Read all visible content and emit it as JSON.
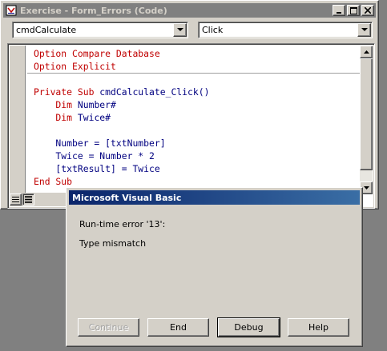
{
  "window": {
    "title": "Exercise - Form_Errors (Code)",
    "icon": "vba-module-icon"
  },
  "object_combo": {
    "value": "cmdCalculate"
  },
  "procedure_combo": {
    "value": "Click"
  },
  "code": {
    "header_lines": [
      "Option Compare Database",
      "Option Explicit"
    ],
    "proc_lines": [
      {
        "kw": "Private Sub",
        "rest": " cmdCalculate_Click()"
      },
      {
        "kw": "    Dim",
        "rest": " Number#"
      },
      {
        "kw": "    Dim",
        "rest": " Twice#"
      },
      {
        "kw": "",
        "rest": ""
      },
      {
        "kw": "",
        "rest": "    Number = [txtNumber]"
      },
      {
        "kw": "",
        "rest": "    Twice = Number * 2"
      },
      {
        "kw": "",
        "rest": "    [txtResult] = Twice"
      },
      {
        "kw": "End Sub",
        "rest": ""
      }
    ]
  },
  "dialog": {
    "title": "Microsoft Visual Basic",
    "error_line": "Run-time error '13':",
    "message": "Type mismatch",
    "buttons": {
      "continue": "Continue",
      "end": "End",
      "debug": "Debug",
      "help": "Help"
    }
  },
  "colors": {
    "keyword_header": "#c00000",
    "code_text": "#000080",
    "title_active_start": "#0a246a",
    "title_active_end": "#3a6ea5",
    "title_inactive": "#808080"
  }
}
